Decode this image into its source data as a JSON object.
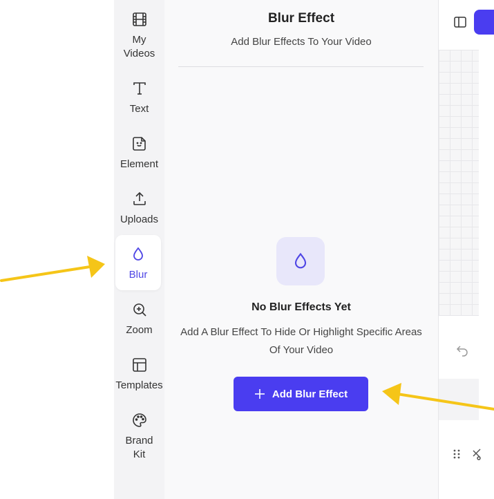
{
  "sidebar": {
    "items": [
      {
        "label": "My\nVideos",
        "icon": "film-icon"
      },
      {
        "label": "Text",
        "icon": "text-icon"
      },
      {
        "label": "Element",
        "icon": "sticker-icon"
      },
      {
        "label": "Uploads",
        "icon": "upload-icon"
      },
      {
        "label": "Blur",
        "icon": "droplet-icon",
        "active": true
      },
      {
        "label": "Zoom",
        "icon": "zoom-in-icon"
      },
      {
        "label": "Templates",
        "icon": "layout-icon"
      },
      {
        "label": "Brand\nKit",
        "icon": "palette-icon"
      }
    ]
  },
  "panel": {
    "title": "Blur Effect",
    "subtitle": "Add Blur Effects To Your Video",
    "empty_title": "No Blur Effects Yet",
    "empty_description": "Add A Blur Effect To Hide Or Highlight Specific Areas Of Your Video",
    "add_button_label": "Add Blur Effect"
  },
  "colors": {
    "accent": "#4a3df0",
    "active_text": "#4f46e5",
    "annotation_arrow": "#f5c518"
  }
}
